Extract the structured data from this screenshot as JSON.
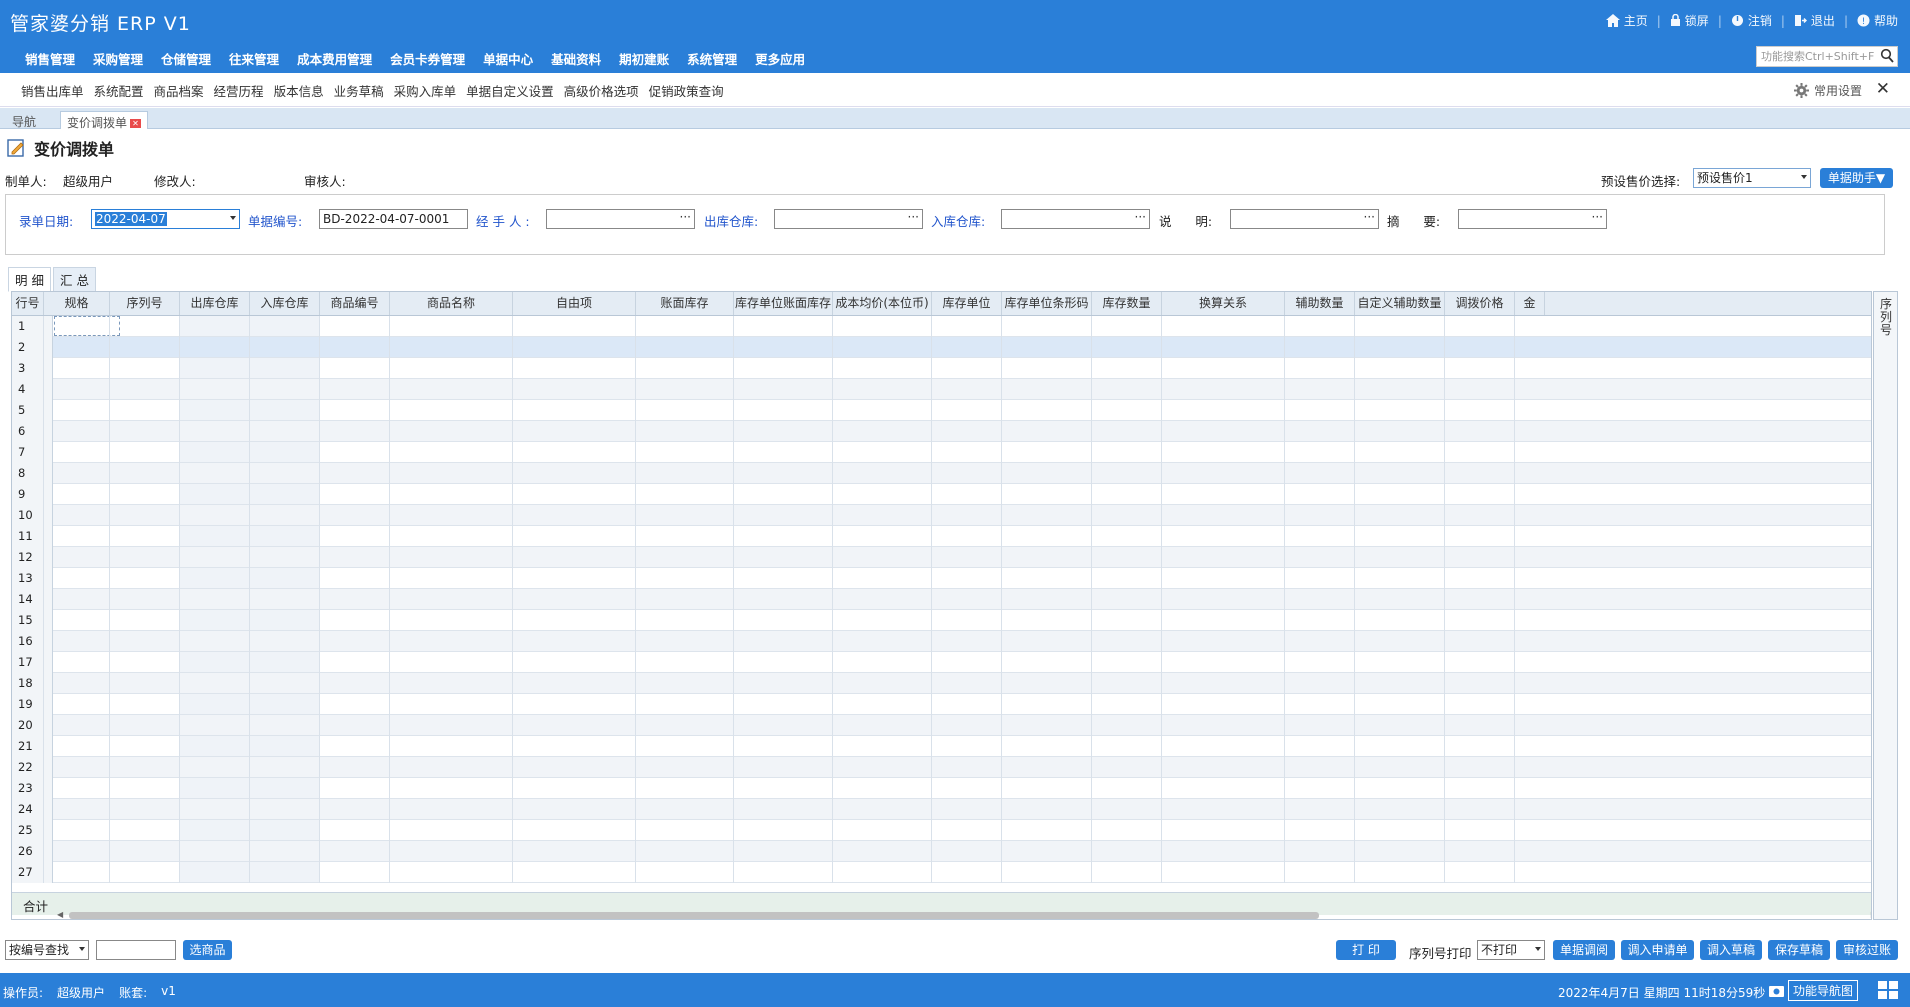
{
  "header": {
    "title": "管家婆分销 ERP V1",
    "links": [
      {
        "label": "主页",
        "icon": "home-icon"
      },
      {
        "label": "锁屏",
        "icon": "lock-icon"
      },
      {
        "label": "注销",
        "icon": "power-icon"
      },
      {
        "label": "退出",
        "icon": "exit-icon"
      },
      {
        "label": "帮助",
        "icon": "help-icon"
      }
    ],
    "search_placeholder": "功能搜索Ctrl+Shift+F"
  },
  "main_nav": [
    "销售管理",
    "采购管理",
    "仓储管理",
    "往来管理",
    "成本费用管理",
    "会员卡券管理",
    "单据中心",
    "基础资料",
    "期初建账",
    "系统管理",
    "更多应用"
  ],
  "quick_links": [
    "销售出库单",
    "系统配置",
    "商品档案",
    "经营历程",
    "版本信息",
    "业务草稿",
    "采购入库单",
    "单据自定义设置",
    "高级价格选项",
    "促销政策查询"
  ],
  "quick_settings": "常用设置",
  "tabs": [
    {
      "label": "导航"
    },
    {
      "label": "变价调拨单"
    }
  ],
  "page_title": "变价调拨单",
  "meta": {
    "maker_label": "制单人:",
    "maker_value": "超级用户",
    "modifier_label": "修改人:",
    "auditor_label": "审核人:",
    "preset_label": "预设售价选择:",
    "preset_value": "预设售价1",
    "helper_button": "单据助手▼"
  },
  "form": {
    "date_label": "录单日期:",
    "date_value": "2022-04-07",
    "billno_label": "单据编号:",
    "billno_value": "BD-2022-04-07-0001",
    "handler_label": "经 手 人 :",
    "out_wh_label": "出库仓库:",
    "in_wh_label": "入库仓库:",
    "note_label": "说      明:",
    "summary_label": "摘      要:"
  },
  "sub_tabs": [
    "明 细",
    "汇 总"
  ],
  "grid": {
    "columns": [
      "行号",
      "规格",
      "序列号",
      "出库仓库",
      "入库仓库",
      "商品编号",
      "商品名称",
      "自由项",
      "账面库存",
      "库存单位账面库存",
      "成本均价(本位币)",
      "库存单位",
      "库存单位条形码",
      "库存数量",
      "换算关系",
      "辅助数量",
      "自定义辅助数量",
      "调拨价格",
      "金"
    ],
    "row_numbers": [
      "1",
      "2",
      "3",
      "4",
      "5",
      "6",
      "7",
      "8",
      "9",
      "10",
      "11",
      "12",
      "13",
      "14",
      "15",
      "16",
      "17",
      "18",
      "19",
      "20",
      "21",
      "22",
      "23",
      "24",
      "25",
      "26",
      "27"
    ],
    "sum_label": "合计",
    "side_label": "序列号"
  },
  "bottom": {
    "search_mode": "按编号查找",
    "select_goods": "选商品",
    "print": "打 印",
    "serial_print_label": "序列号打印",
    "serial_print_value": "不打印",
    "buttons": [
      "单据调阅",
      "调入申请单",
      "调入草稿",
      "保存草稿",
      "审核过账"
    ]
  },
  "status": {
    "operator_label": "操作员:",
    "operator": "超级用户",
    "account_label": "账套:",
    "account": "v1",
    "datetime": "2022年4月7日  星期四  11时18分59秒",
    "nav_map": "功能导航图"
  },
  "colors": {
    "primary": "#2a7fd8",
    "link_label": "#2255cc"
  }
}
